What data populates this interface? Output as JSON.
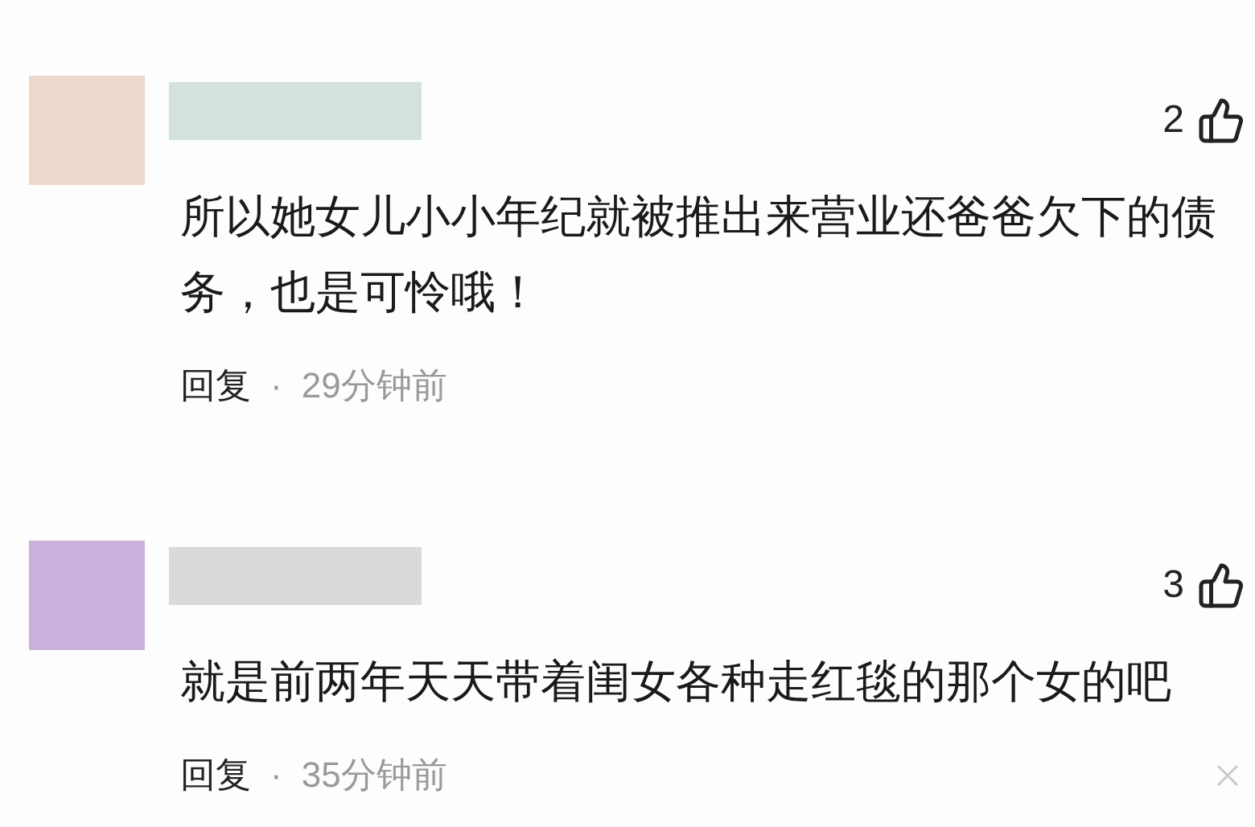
{
  "comments": [
    {
      "likes": "2",
      "lines": [
        "所以她女儿小小年纪就被推出来营业还爸爸欠下的债",
        "务，也是可怜哦！"
      ],
      "reply": "回复",
      "separator": "·",
      "time": "29分钟前",
      "closable": false
    },
    {
      "likes": "3",
      "lines": [
        "就是前两年天天带着闺女各种走红毯的那个女的吧"
      ],
      "reply": "回复",
      "separator": "·",
      "time": "35分钟前",
      "closable": true
    }
  ]
}
